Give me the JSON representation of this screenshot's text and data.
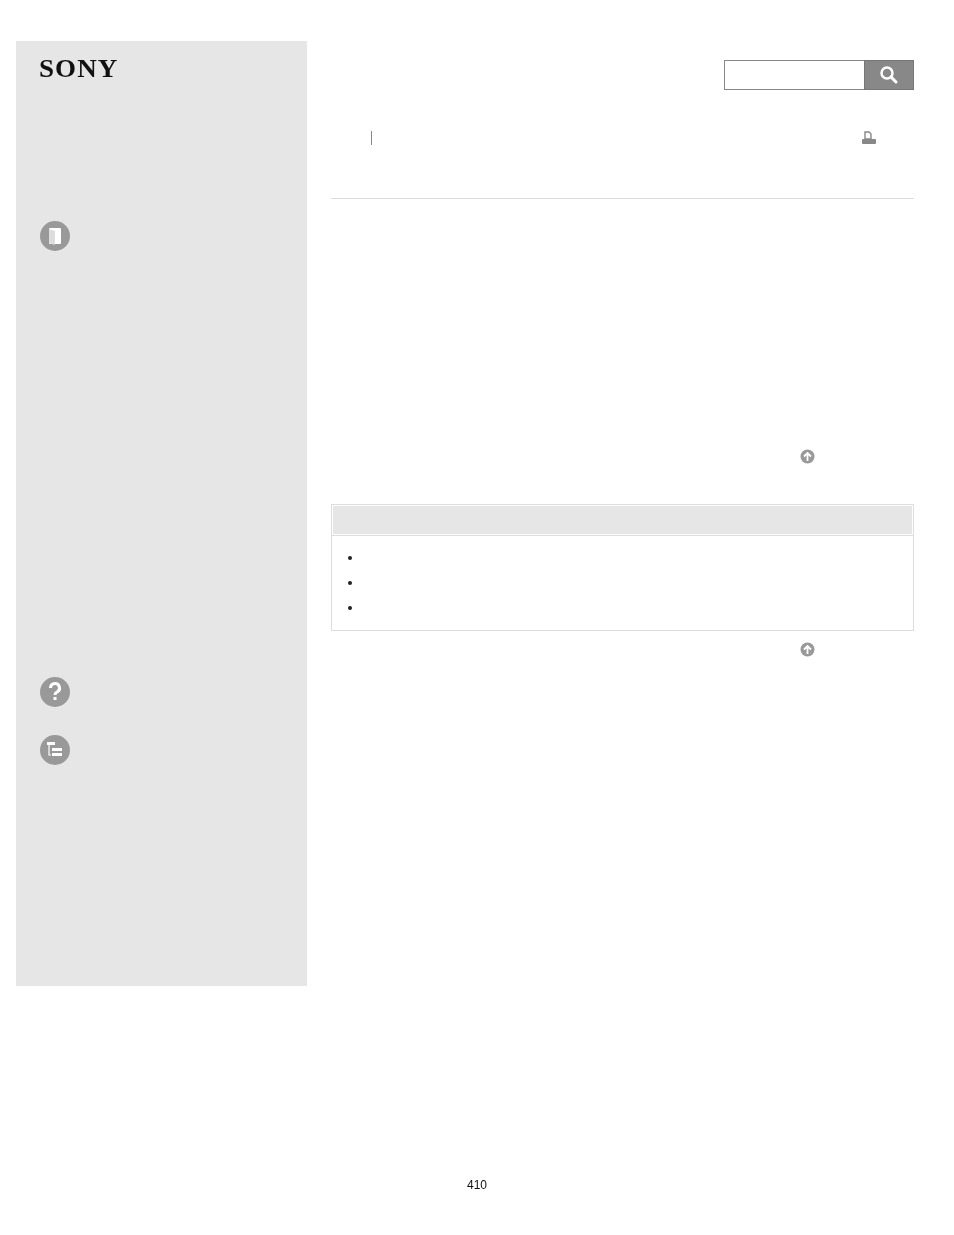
{
  "sidebar": {
    "logo": "SONY",
    "icons": [
      {
        "kind": "book"
      },
      {
        "kind": "help"
      },
      {
        "kind": "tree"
      }
    ]
  },
  "search": {
    "kind": "search"
  },
  "notes": {
    "items": [
      {
        "kind": "bullet"
      },
      {
        "kind": "bullet"
      },
      {
        "kind": "bullet"
      }
    ]
  },
  "page_number": "410"
}
